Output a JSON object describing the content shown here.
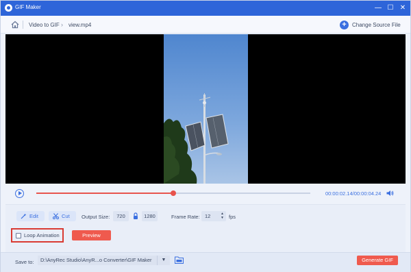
{
  "window": {
    "title": "GIF Maker",
    "minimize": "—",
    "maximize": "☐",
    "close": "✕"
  },
  "breadcrumb": {
    "items": [
      "Video to GIF",
      "view.mp4"
    ],
    "separator": "›"
  },
  "header": {
    "change_source_label": "Change Source File",
    "plus": "+"
  },
  "player": {
    "current_time": "00:00:02.14",
    "separator": "/",
    "total_time": "00:00:04.24",
    "progress": 0.5
  },
  "toolbar": {
    "edit_label": "Edit",
    "cut_label": "Cut",
    "output_size_label": "Output Size:",
    "width": "720",
    "height": "1280",
    "frame_rate_label": "Frame Rate:",
    "frame_rate": "12",
    "fps_label": "fps",
    "stepper_up": "▲",
    "stepper_down": "▼"
  },
  "options": {
    "loop_label": "Loop Animation",
    "loop_checked": false,
    "preview_label": "Preview"
  },
  "save": {
    "label": "Save to:",
    "path": "D:\\AnyRec Studio\\AnyR...o Converter\\GIF Maker",
    "dropdown": "▼",
    "generate_label": "Generate GIF"
  },
  "colors": {
    "title_bar": "#2e65d9",
    "accent": "#3a6fe0",
    "action_red": "#ef5a4e",
    "highlight_border": "#d93a32"
  },
  "icons": [
    "app-logo-icon",
    "home-icon",
    "plus-circle-icon",
    "play-icon",
    "volume-icon",
    "edit-wand-icon",
    "scissors-icon",
    "lock-icon",
    "folder-icon"
  ]
}
